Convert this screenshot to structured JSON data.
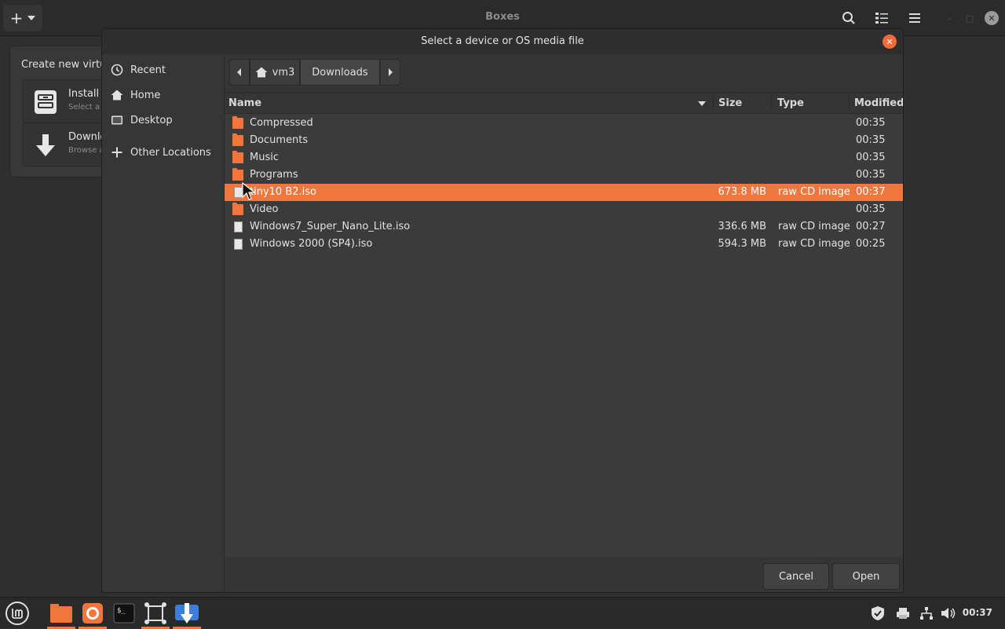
{
  "app": {
    "title": "Boxes"
  },
  "popover": {
    "title": "Create new virtual machine",
    "title_visible": "Create new virtu",
    "items": [
      {
        "label": "Install",
        "sub": "Select a",
        "icon": "install-media-icon"
      },
      {
        "label": "Downlo",
        "sub": "Browse a",
        "icon": "download-icon"
      }
    ]
  },
  "dialog": {
    "title": "Select a device or OS media file",
    "sidebar": [
      {
        "label": "Recent",
        "icon": "clock-icon"
      },
      {
        "label": "Home",
        "icon": "home-icon"
      },
      {
        "label": "Desktop",
        "icon": "desktop-icon"
      },
      {
        "label": "Other Locations",
        "icon": "plus-icon"
      }
    ],
    "path": {
      "home_label": "vm3",
      "current": "Downloads"
    },
    "columns": {
      "name": "Name",
      "size": "Size",
      "type": "Type",
      "modified": "Modified"
    },
    "files": [
      {
        "name": "Compressed",
        "size": "",
        "type": "",
        "modified": "00:35",
        "kind": "folder"
      },
      {
        "name": "Documents",
        "size": "",
        "type": "",
        "modified": "00:35",
        "kind": "folder"
      },
      {
        "name": "Music",
        "size": "",
        "type": "",
        "modified": "00:35",
        "kind": "folder"
      },
      {
        "name": "Programs",
        "size": "",
        "type": "",
        "modified": "00:35",
        "kind": "folder"
      },
      {
        "name": "tiny10 B2.iso",
        "size": "673.8 MB",
        "type": "raw CD image",
        "modified": "00:37",
        "kind": "file",
        "selected": true
      },
      {
        "name": "Video",
        "size": "",
        "type": "",
        "modified": "00:35",
        "kind": "folder"
      },
      {
        "name": "Windows7_Super_Nano_Lite.iso",
        "size": "336.6 MB",
        "type": "raw CD image",
        "modified": "00:27",
        "kind": "file"
      },
      {
        "name": "Windows 2000 (SP4).iso",
        "size": "594.3 MB",
        "type": "raw CD image",
        "modified": "00:25",
        "kind": "file"
      }
    ],
    "buttons": {
      "cancel": "Cancel",
      "open": "Open"
    }
  },
  "taskbar": {
    "clock": "00:37",
    "apps": [
      "mint-menu-icon",
      "files-icon",
      "firefox-icon",
      "terminal-icon",
      "boxes-icon",
      "update-manager-icon"
    ]
  },
  "colors": {
    "accent": "#f0763d",
    "background": "#2f2f2f"
  }
}
